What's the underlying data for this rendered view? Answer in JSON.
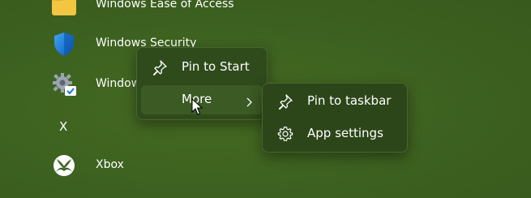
{
  "app_list": {
    "items": [
      {
        "label": "Windows Ease of Access",
        "icon": "folder-icon"
      },
      {
        "label": "Windows Security",
        "icon": "shield-icon"
      },
      {
        "label": "Windows Tools",
        "icon": "gear-icon"
      }
    ],
    "section_letter": "X",
    "xbox": {
      "label": "Xbox",
      "icon": "xbox-icon"
    }
  },
  "context_menu": {
    "pin_to_start": {
      "label": "Pin to Start",
      "icon": "pin-icon"
    },
    "more": {
      "label": "More",
      "icon": "chevron-right-icon"
    }
  },
  "submenu": {
    "pin_to_taskbar": {
      "label": "Pin to taskbar",
      "icon": "pin-icon"
    },
    "app_settings": {
      "label": "App settings",
      "icon": "gear-icon"
    }
  },
  "colors": {
    "background": "#3e6220",
    "menu_background": "#2f4a1b",
    "menu_hover": "#3b5a24",
    "text": "#ffffff"
  }
}
